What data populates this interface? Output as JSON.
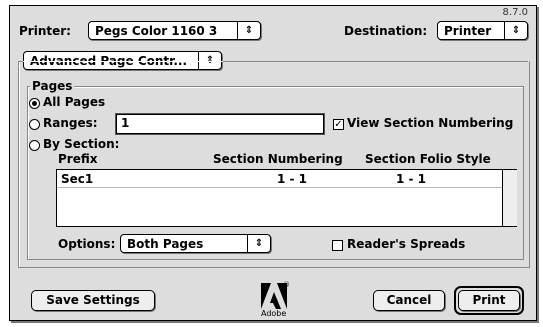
{
  "version": "8.7.0",
  "printer": {
    "label": "Printer:",
    "value": "Pegs Color 1160 3"
  },
  "destination": {
    "label": "Destination:",
    "value": "Printer"
  },
  "panel_popup": {
    "value": "Advanced Page Contr..."
  },
  "pages": {
    "group_label": "Pages",
    "all_pages": "All Pages",
    "ranges": "Ranges:",
    "ranges_value": "1",
    "view_section_numbering": "View Section Numbering",
    "by_section": "By Section:",
    "columns": [
      "Prefix",
      "Section Numbering",
      "Section Folio Style"
    ],
    "rows": [
      {
        "prefix": "Sec1",
        "numbering": "1 - 1",
        "folio": "1 - 1"
      }
    ],
    "options_label": "Options:",
    "options_value": "Both Pages",
    "readers_spreads": "Reader's Spreads"
  },
  "buttons": {
    "save_settings": "Save Settings",
    "cancel": "Cancel",
    "print": "Print"
  },
  "logo": {
    "text": "Adobe",
    "registered": "®"
  },
  "state": {
    "selected_radio": "all_pages",
    "view_section_numbering_checked": true,
    "readers_spreads_checked": false
  },
  "icons": {
    "popup_arrow": "up-down-arrows-icon",
    "check": "checkmark-icon"
  }
}
